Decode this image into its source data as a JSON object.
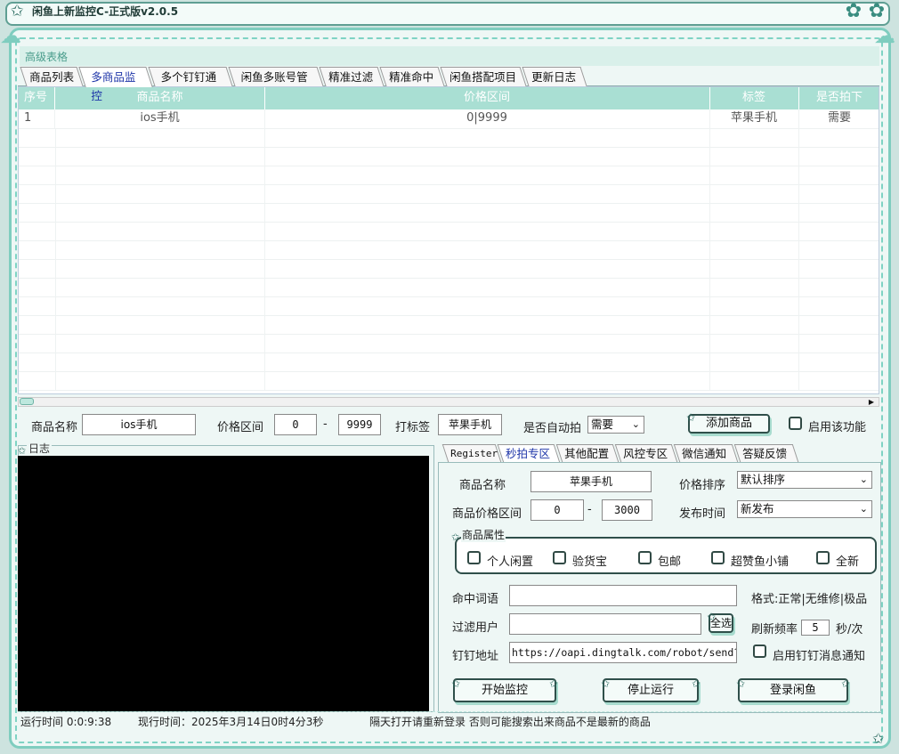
{
  "window": {
    "title": "闲鱼上新监控C-正式版v2.0.5",
    "icons": [
      "star-icon",
      "minimize-icon",
      "close-icon"
    ]
  },
  "section_header": "高级表格",
  "top_tabs": [
    "商品列表",
    "多商品监控",
    "多个钉钉通知",
    "闲鱼多账号管理",
    "精准过滤",
    "精准命中",
    "闲鱼搭配项目",
    "更新日志"
  ],
  "top_tabs_active": 1,
  "table": {
    "columns": [
      "序号",
      "商品名称",
      "价格区间",
      "标签",
      "是否拍下"
    ],
    "rows": [
      [
        "1",
        "ios手机",
        "0|9999",
        "苹果手机",
        "需要"
      ]
    ]
  },
  "monitor_form": {
    "name_label": "商品名称",
    "name_value": "ios手机",
    "price_label": "价格区间",
    "price_min": "0",
    "dash": "-",
    "price_max": "9999",
    "tag_label": "打标签",
    "tag_value": "苹果手机",
    "auto_label": "是否自动拍",
    "auto_value": "需要",
    "add_button": "添加商品",
    "enable_label": "启用该功能"
  },
  "log_label": "日志",
  "right_tabs": [
    "Register",
    "秒拍专区",
    "其他配置",
    "风控专区",
    "微信通知",
    "答疑反馈"
  ],
  "right_tabs_active": 1,
  "flash": {
    "name_label": "商品名称",
    "name_value": "苹果手机",
    "sort_label": "价格排序",
    "sort_value": "默认排序",
    "range_label": "商品价格区间",
    "range_min": "0",
    "dash": "-",
    "range_max": "3000",
    "time_label": "发布时间",
    "time_value": "新发布",
    "props_label": "商品属性",
    "props": [
      "个人闲置",
      "验货宝",
      "包邮",
      "超赞鱼小铺",
      "全新"
    ],
    "hit_label": "命中词语",
    "hit_value": "",
    "format_hint": "格式:正常|无维修|极品",
    "filter_label": "过滤用户",
    "filter_value": "",
    "select_all": "全选",
    "refresh_label": "刷新频率",
    "refresh_value": "5",
    "refresh_unit": "秒/次",
    "ding_label": "钉钉地址",
    "ding_value": "https://oapi.dingtalk.com/robot/send?access",
    "ding_enable_label": "启用钉钉消息通知",
    "start_button": "开始监控",
    "stop_button": "停止运行",
    "login_button": "登录闲鱼"
  },
  "status_bar": {
    "runtime": "运行时间 0:0:9:38",
    "now": "现行时间：2025年3月14日0时4分3秒",
    "notice": "隔天打开请重新登录  否则可能搜索出来商品不是最新的商品"
  }
}
